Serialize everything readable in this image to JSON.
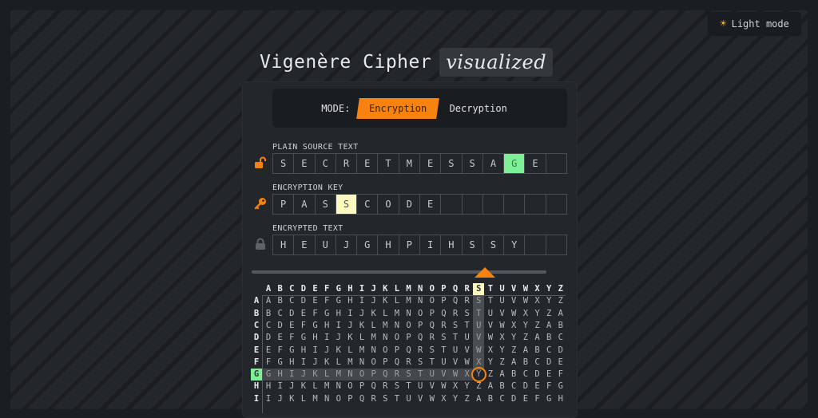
{
  "theme_toggle": {
    "icon": "sun-icon",
    "label": "Light mode"
  },
  "header": {
    "title": "Vigenère Cipher",
    "highlight": "visualized"
  },
  "mode": {
    "label": "MODE:",
    "options": [
      "Encryption",
      "Decryption"
    ],
    "active": "Encryption"
  },
  "fields": {
    "plain": {
      "label": "PLAIN SOURCE TEXT",
      "icon": "unlocked-padlock-icon",
      "letters": [
        "S",
        "E",
        "C",
        "R",
        "E",
        "T",
        "M",
        "E",
        "S",
        "S",
        "A",
        "G",
        "E",
        ""
      ],
      "highlight_index": 11
    },
    "key": {
      "label": "ENCRYPTION KEY",
      "icon": "key-icon",
      "letters": [
        "P",
        "A",
        "S",
        "S",
        "C",
        "O",
        "D",
        "E",
        "",
        "",
        "",
        "",
        "",
        ""
      ],
      "highlight_index": 3
    },
    "encrypted": {
      "label": "ENCRYPTED TEXT",
      "icon": "locked-padlock-icon",
      "letters": [
        "H",
        "E",
        "U",
        "J",
        "G",
        "H",
        "P",
        "I",
        "H",
        "S",
        "S",
        "Y",
        "",
        ""
      ]
    }
  },
  "slider": {
    "step": 12,
    "total_steps": 14
  },
  "tableau": {
    "alphabet": "ABCDEFGHIJKLMNOPQRSTUVWXYZ",
    "visible_rows": 9,
    "highlight_column": "S",
    "highlight_row": "G",
    "result_letter": "Y"
  }
}
